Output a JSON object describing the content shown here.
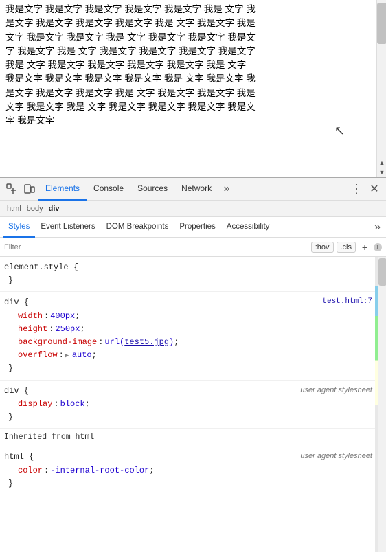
{
  "viewport": {
    "text_repeated": "我是文字",
    "text_block": "我是文字 我是文字 我是文字 我是文字 我是文字 我是 文字 我是文字 我是文字 我是文字 我是文字 我是 文字 我是文字 我是文字 我是文字 我是文字 我是 文字 我是文字 我是文字 我是文字 我是文字 我是 文字 我是文字 我是文字 我是文字 我是文字 我是 文字 我是文字 我是文字 我是文字 我是文字 我是 文字 我是文字 我是文字 我是文字 我是文字 我是 文字 我是文字 我是文字 我是文字 我是文字 我是 文字 我是文字 我是文字 我是文字 我是文字 我是 文字 我是文字 我是文字 我是文字 我是文字 我是文字"
  },
  "devtools": {
    "tabs": [
      {
        "label": "Elements",
        "active": true
      },
      {
        "label": "Console",
        "active": false
      },
      {
        "label": "Sources",
        "active": false
      },
      {
        "label": "Network",
        "active": false
      }
    ],
    "more_icon": "»",
    "close_icon": "✕",
    "options_icon": "⋮"
  },
  "breadcrumb": {
    "items": [
      {
        "label": "‹body›",
        "active": false
      },
      {
        "label": "div",
        "active": false
      }
    ],
    "html_label": "html",
    "body_label": "body",
    "div_label": "div"
  },
  "styles_panel": {
    "tabs": [
      {
        "label": "Styles",
        "active": true
      },
      {
        "label": "Event Listeners",
        "active": false
      },
      {
        "label": "DOM Breakpoints",
        "active": false
      },
      {
        "label": "Properties",
        "active": false
      },
      {
        "label": "Accessibility",
        "active": false
      }
    ],
    "more_icon": "»",
    "filter_placeholder": "Filter",
    "hov_btn": ":hov",
    "cls_btn": ".cls",
    "plus_btn": "+"
  },
  "css_rules": [
    {
      "selector": "element.style {",
      "source": "",
      "properties": [],
      "close": "}"
    },
    {
      "selector": "div {",
      "source": "test.html:7",
      "properties": [
        {
          "name": "width",
          "value": "400px",
          "link": false
        },
        {
          "name": "height",
          "value": "250px",
          "link": false
        },
        {
          "name": "background-image",
          "value_prefix": "url(",
          "value_link": "test5.jpg",
          "value_suffix": ");",
          "link": true
        },
        {
          "name": "overflow",
          "value": "▶ auto",
          "link": false,
          "has_triangle": true
        }
      ],
      "close": "}"
    },
    {
      "selector": "div {",
      "source": "user agent stylesheet",
      "properties": [
        {
          "name": "display",
          "value": "block",
          "link": false
        }
      ],
      "close": "}"
    }
  ],
  "inherited": {
    "label": "Inherited from",
    "keyword": "html"
  },
  "inherited_rules": [
    {
      "selector": "html {",
      "source": "user agent stylesheet",
      "properties": [
        {
          "name": "color",
          "value": "-internal-root-color",
          "link": false
        }
      ],
      "close": "}"
    }
  ]
}
